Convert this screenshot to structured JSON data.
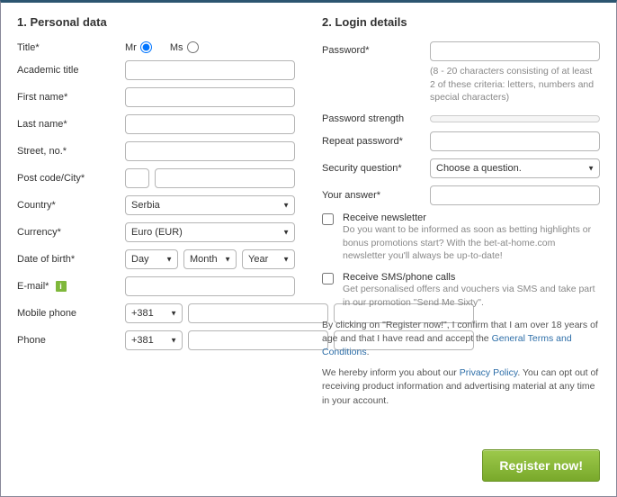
{
  "personal": {
    "heading": "1. Personal data",
    "title_label": "Title*",
    "title_mr": "Mr",
    "title_ms": "Ms",
    "academic_label": "Academic title",
    "firstname_label": "First name*",
    "lastname_label": "Last name*",
    "street_label": "Street, no.*",
    "postcity_label": "Post code/City*",
    "country_label": "Country*",
    "country_value": "Serbia",
    "currency_label": "Currency*",
    "currency_value": "Euro (EUR)",
    "dob_label": "Date of birth*",
    "dob_day": "Day",
    "dob_month": "Month",
    "dob_year": "Year",
    "email_label": "E-mail*",
    "mobile_label": "Mobile phone",
    "phone_label": "Phone",
    "phone_code": "+381"
  },
  "login": {
    "heading": "2. Login details",
    "password_label": "Password*",
    "password_hint": "(8 - 20 characters consisting of at least 2 of these criteria: letters, numbers and special characters)",
    "strength_label": "Password strength",
    "repeat_label": "Repeat password*",
    "question_label": "Security question*",
    "question_value": "Choose a question.",
    "answer_label": "Your answer*",
    "newsletter_label": "Receive newsletter",
    "newsletter_sub": "Do you want to be informed as soon as betting highlights or bonus promotions start? With the bet-at-home.com newsletter you'll always be up-to-date!",
    "sms_label": "Receive SMS/phone calls",
    "sms_sub": "Get personalised offers and vouchers via SMS and take part in our promotion \"Send Me Sixty\".",
    "legal1_a": "By clicking on \"Register now!\", I confirm that I am over 18 years of age and that I have read and accept the ",
    "legal1_link": "General Terms and Conditions",
    "legal2_a": "We hereby inform you about our ",
    "legal2_link": "Privacy Policy",
    "legal2_b": ". You can opt out of receiving product information and advertising material at any time in your account.",
    "submit": "Register now!"
  }
}
